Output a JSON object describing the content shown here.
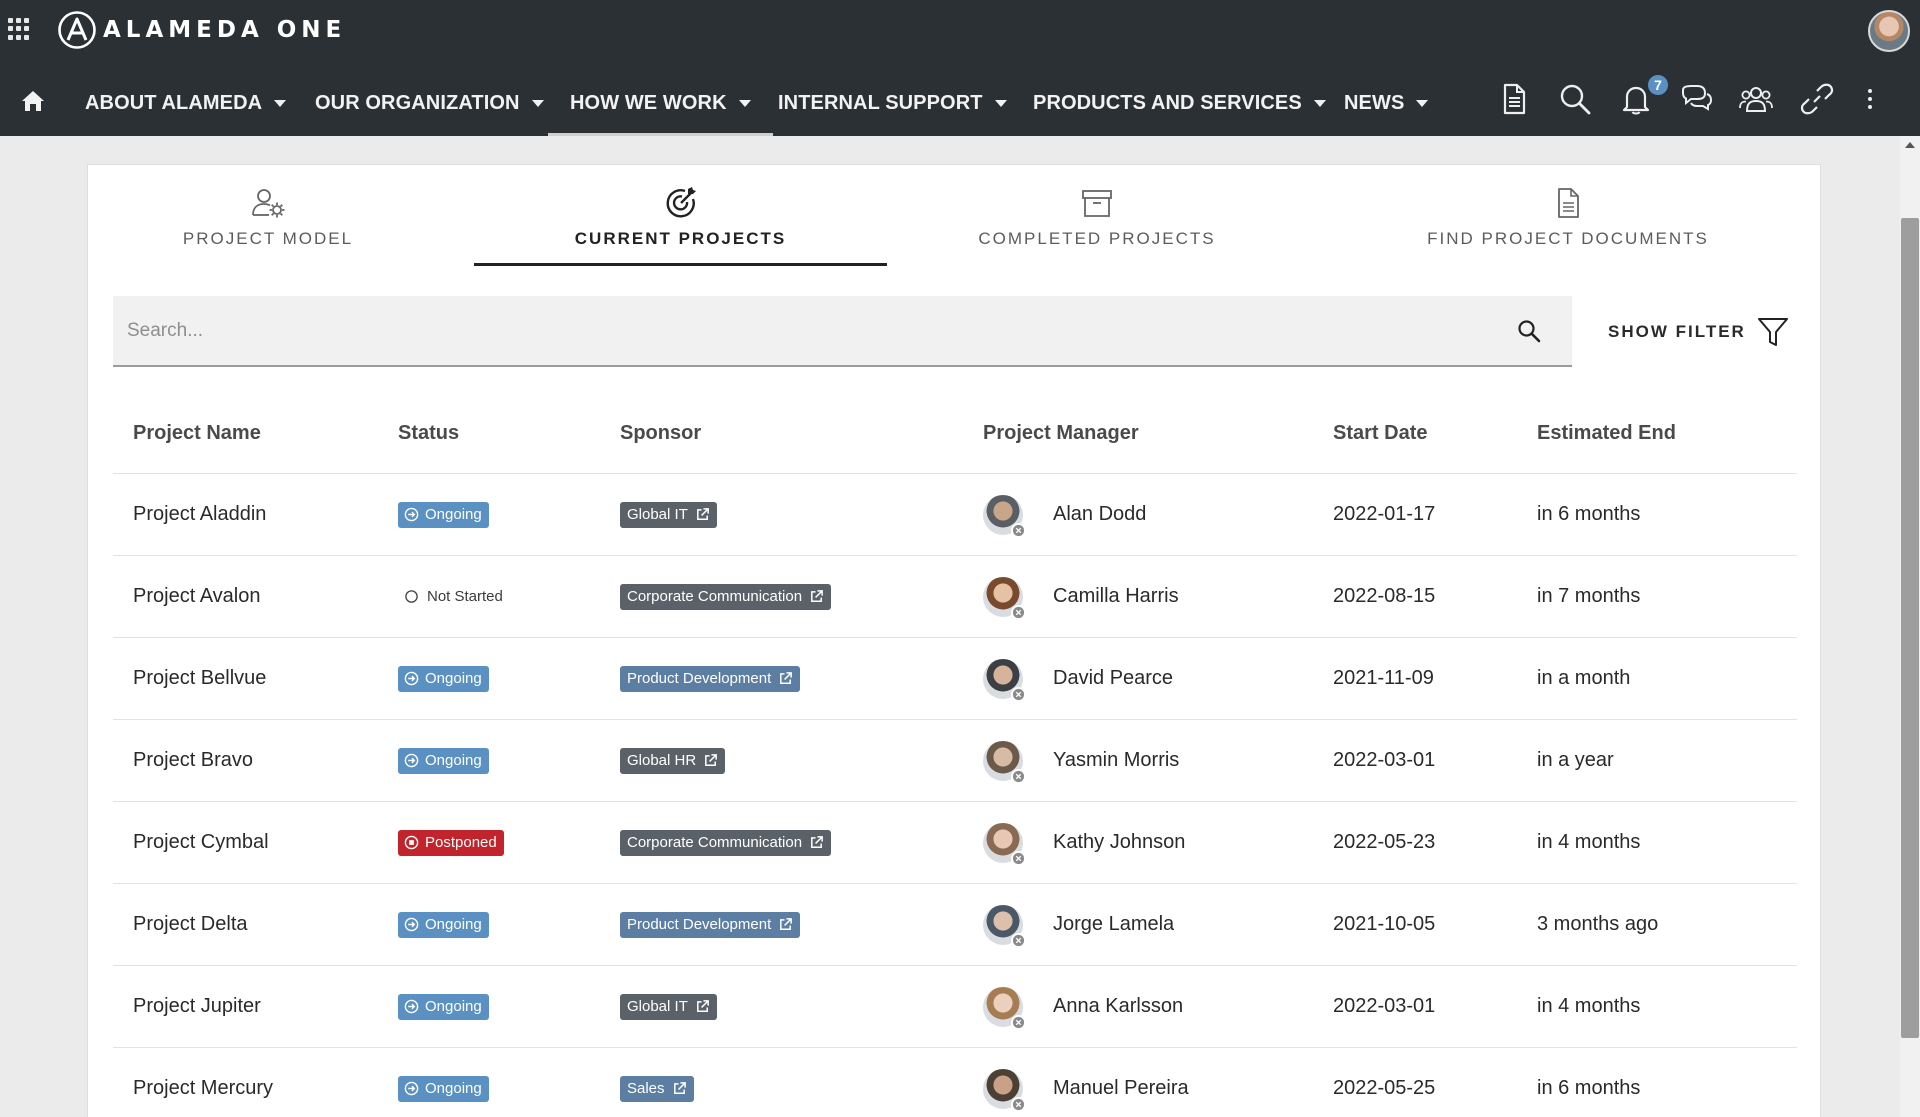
{
  "app": {
    "brand": "ALAMEDA ONE"
  },
  "nav": {
    "home": "home-icon",
    "items": [
      {
        "label": "ABOUT ALAMEDA"
      },
      {
        "label": "OUR ORGANIZATION"
      },
      {
        "label": "HOW WE WORK",
        "active": true
      },
      {
        "label": "INTERNAL SUPPORT"
      },
      {
        "label": "PRODUCTS AND SERVICES"
      },
      {
        "label": "NEWS"
      }
    ],
    "notifications_count": "7"
  },
  "tabs": [
    {
      "label": "PROJECT MODEL",
      "icon": "user-gear-icon"
    },
    {
      "label": "CURRENT PROJECTS",
      "icon": "target-icon",
      "active": true
    },
    {
      "label": "COMPLETED PROJECTS",
      "icon": "archive-icon"
    },
    {
      "label": "FIND PROJECT DOCUMENTS",
      "icon": "document-icon"
    }
  ],
  "search": {
    "placeholder": "Search...",
    "value": ""
  },
  "filter": {
    "label": "SHOW FILTER"
  },
  "table": {
    "columns": [
      "Project Name",
      "Status",
      "Sponsor",
      "Project Manager",
      "Start Date",
      "Estimated End"
    ],
    "rows": [
      {
        "name": "Project Aladdin",
        "status": "Ongoing",
        "sponsor": "Global IT",
        "manager": "Alan Dodd",
        "start": "2022-01-17",
        "end": "in 6 months"
      },
      {
        "name": "Project Avalon",
        "status": "Not Started",
        "sponsor": "Corporate Communication",
        "manager": "Camilla Harris",
        "start": "2022-08-15",
        "end": "in 7 months"
      },
      {
        "name": "Project Bellvue",
        "status": "Ongoing",
        "sponsor": "Product Development",
        "manager": "David Pearce",
        "start": "2021-11-09",
        "end": "in a month"
      },
      {
        "name": "Project Bravo",
        "status": "Ongoing",
        "sponsor": "Global HR",
        "manager": "Yasmin Morris",
        "start": "2022-03-01",
        "end": "in a year"
      },
      {
        "name": "Project Cymbal",
        "status": "Postponed",
        "sponsor": "Corporate Communication",
        "manager": "Kathy Johnson",
        "start": "2022-05-23",
        "end": "in 4 months"
      },
      {
        "name": "Project Delta",
        "status": "Ongoing",
        "sponsor": "Product Development",
        "manager": "Jorge Lamela",
        "start": "2021-10-05",
        "end": "3 months ago"
      },
      {
        "name": "Project Jupiter",
        "status": "Ongoing",
        "sponsor": "Global IT",
        "manager": "Anna Karlsson",
        "start": "2022-03-01",
        "end": "in 4 months"
      },
      {
        "name": "Project Mercury",
        "status": "Ongoing",
        "sponsor": "Sales",
        "manager": "Manuel Pereira",
        "start": "2022-05-25",
        "end": "in 6 months"
      }
    ]
  },
  "colors": {
    "topbar": "#2b3034",
    "ongoing": "#5b91c2",
    "postponed": "#c2242b",
    "sponsor_gray": "#5b6168",
    "sponsor_blue": "#5b7ea2",
    "badge_blue": "#5b91c2"
  }
}
